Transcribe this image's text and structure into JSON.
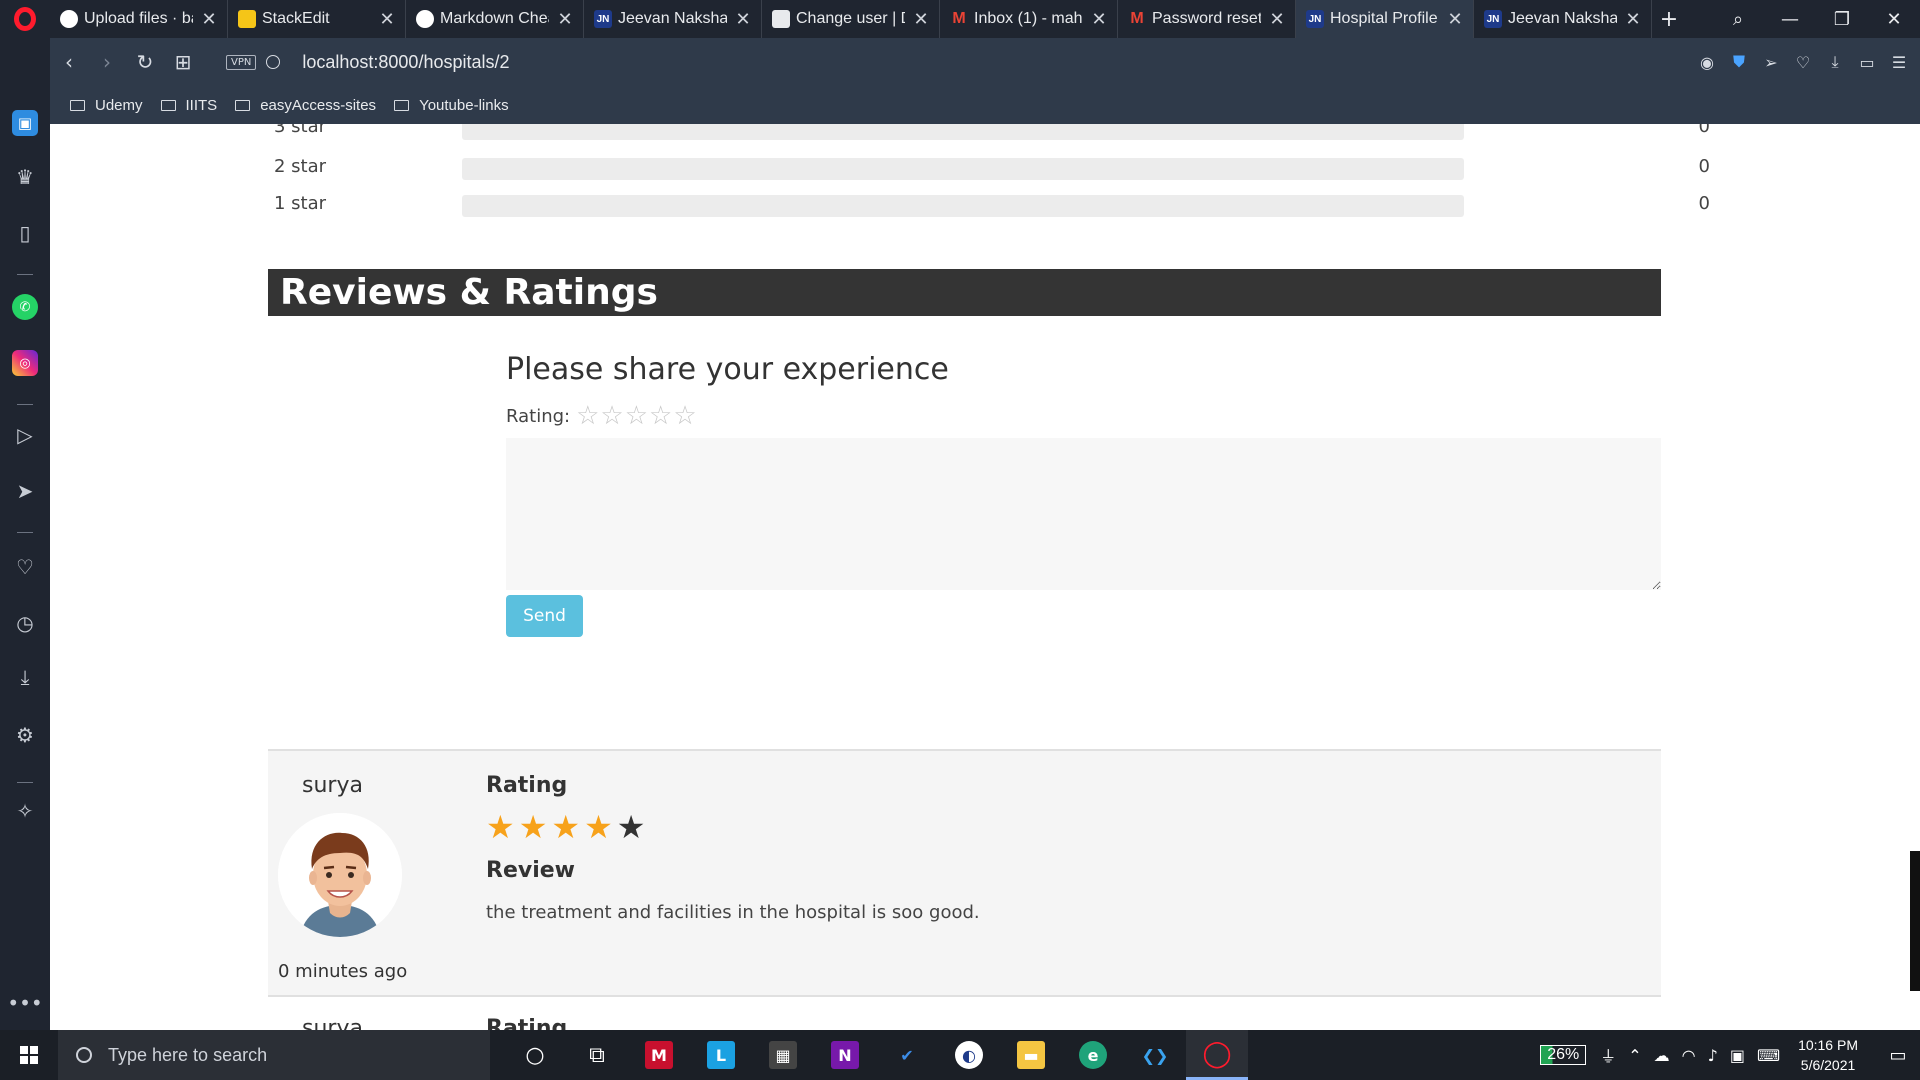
{
  "browser": {
    "tabs": [
      {
        "label": "Upload files · ba",
        "favicon": "github-icon",
        "active": false
      },
      {
        "label": "StackEdit",
        "favicon": "stackedit-icon",
        "active": false
      },
      {
        "label": "Markdown Chea",
        "favicon": "github-icon",
        "active": false
      },
      {
        "label": "Jeevan Naksha",
        "favicon": "jn-icon",
        "active": false
      },
      {
        "label": "Change user | Dj",
        "favicon": "document-icon",
        "active": false
      },
      {
        "label": "Inbox (1) - maha",
        "favicon": "gmail-icon",
        "active": false
      },
      {
        "label": "Password reset o",
        "favicon": "gmail-icon",
        "active": false
      },
      {
        "label": "Hospital Profile",
        "favicon": "jn-icon",
        "active": true
      },
      {
        "label": "Jeevan Naksha",
        "favicon": "jn-icon",
        "active": false
      }
    ],
    "url": "localhost:8000/hospitals/2",
    "vpn_label": "VPN",
    "bookmarks": [
      "Udemy",
      "IIITS",
      "easyAccess-sites",
      "Youtube-links"
    ]
  },
  "page": {
    "star_breakdown": [
      {
        "label": "3 star",
        "count": "0",
        "fraction": 0
      },
      {
        "label": "2 star",
        "count": "0",
        "fraction": 0
      },
      {
        "label": "1 star",
        "count": "0",
        "fraction": 0
      }
    ],
    "section_title": "Reviews & Ratings",
    "form": {
      "title": "Please share your experience",
      "rating_label": "Rating:",
      "empty_stars": "☆☆☆☆☆",
      "textarea_value": "",
      "send_label": "Send"
    },
    "reviews": [
      {
        "user": "surya",
        "time": "0 minutes ago",
        "rating_heading": "Rating",
        "rating": 4,
        "max_rating": 5,
        "review_heading": "Review",
        "text": "the treatment and facilities in the hospital is soo good."
      },
      {
        "user": "surya",
        "rating_heading": "Rating"
      }
    ]
  },
  "taskbar": {
    "search_placeholder": "Type here to search",
    "battery": "26%",
    "time": "10:16 PM",
    "date": "5/6/2021"
  },
  "colors": {
    "accent_star": "#f7a21b",
    "send_button": "#5bc0de",
    "section_header": "#343434"
  }
}
